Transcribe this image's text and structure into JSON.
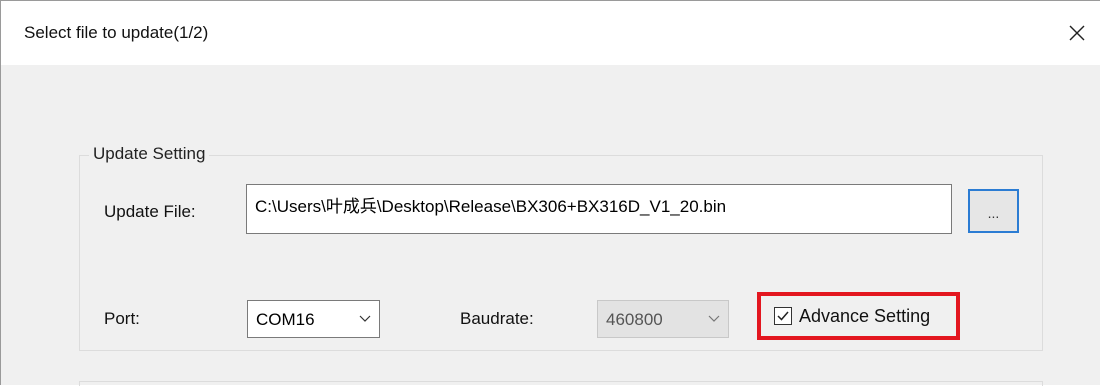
{
  "window": {
    "title": "Select file to update(1/2)",
    "close_icon": "close-icon"
  },
  "update_setting": {
    "group_title": "Update Setting",
    "update_file_label": "Update File:",
    "update_file_value": "C:\\Users\\叶成兵\\Desktop\\Release\\BX306+BX316D_V1_20.bin",
    "browse_label": "...",
    "port_label": "Port:",
    "port_value": "COM16",
    "baudrate_label": "Baudrate:",
    "baudrate_value": "460800",
    "advance_setting_label": "Advance Setting",
    "advance_setting_checked": true,
    "highlight_color": "#e3161f",
    "focus_color": "#2b7cd3"
  }
}
